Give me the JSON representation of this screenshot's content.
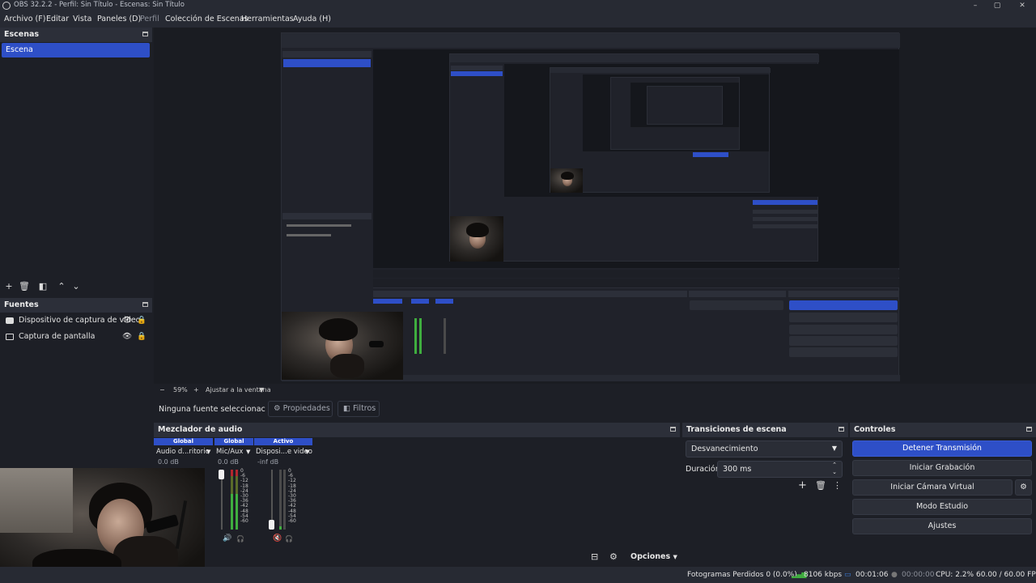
{
  "window": {
    "title": "OBS 32.2.2 - Perfil: Sin Título - Escenas: Sin Título",
    "controls": [
      "–",
      "▢",
      "✕"
    ]
  },
  "menu": {
    "items": [
      "Archivo (F)",
      "Editar",
      "Vista",
      "Paneles (D)",
      "Perfil",
      "Colección de Escenas",
      "Herramientas",
      "Ayuda (H)"
    ]
  },
  "scenes": {
    "title": "Escenas",
    "items": [
      "Escena"
    ]
  },
  "sources": {
    "title": "Fuentes",
    "items": [
      {
        "label": "Dispositivo de captura de video",
        "icon": "camera-icon"
      },
      {
        "label": "Captura de pantalla",
        "icon": "monitor-icon"
      }
    ]
  },
  "zoom": {
    "minus": "−",
    "level": "59%",
    "plus": "+",
    "fit_label": "Ajustar a la ventana",
    "menu": "▼"
  },
  "source_toolbar": {
    "selection": "Ninguna fuente seleccionac",
    "properties": "Propiedades",
    "filters": "Filtros"
  },
  "mixer": {
    "title": "Mezclador de audio",
    "strips": [
      {
        "tag": "Global",
        "name": "Audio d...ritorio",
        "db": "0.0 dB"
      },
      {
        "tag": "Global",
        "name": "Mic/Aux",
        "db": "0.0 dB"
      },
      {
        "tag": "Activo",
        "name": "Disposi...e video",
        "db": "-inf dB"
      }
    ],
    "scale": [
      "0",
      "-6",
      "-12",
      "-18",
      "-24",
      "-30",
      "-36",
      "-42",
      "-48",
      "-54",
      "-60"
    ],
    "options_label": "Opciones"
  },
  "transitions": {
    "title": "Transiciones de escena",
    "type": "Desvanecimiento",
    "duration_label": "Duración",
    "duration_value": "300 ms"
  },
  "controls": {
    "title": "Controles",
    "buttons": [
      "Detener Transmisión",
      "Iniciar Grabación",
      "Iniciar Cámara Virtual",
      "Modo Estudio",
      "Ajustes"
    ]
  },
  "status": {
    "dropped_frames": "Fotogramas Perdidos 0 (0.0%)",
    "bitrate": "8106 kbps",
    "stream_time": "00:01:06",
    "record_time": "00:00:00",
    "cpu": "CPU: 2.2%",
    "fps": "60.00 / 60.00 FPS"
  },
  "colors": {
    "accent": "#2e4fc7",
    "background": "#1d1f26",
    "panel_header": "#2c2f39",
    "meter_green": "#3fae3f",
    "meter_red": "#b3262e"
  }
}
